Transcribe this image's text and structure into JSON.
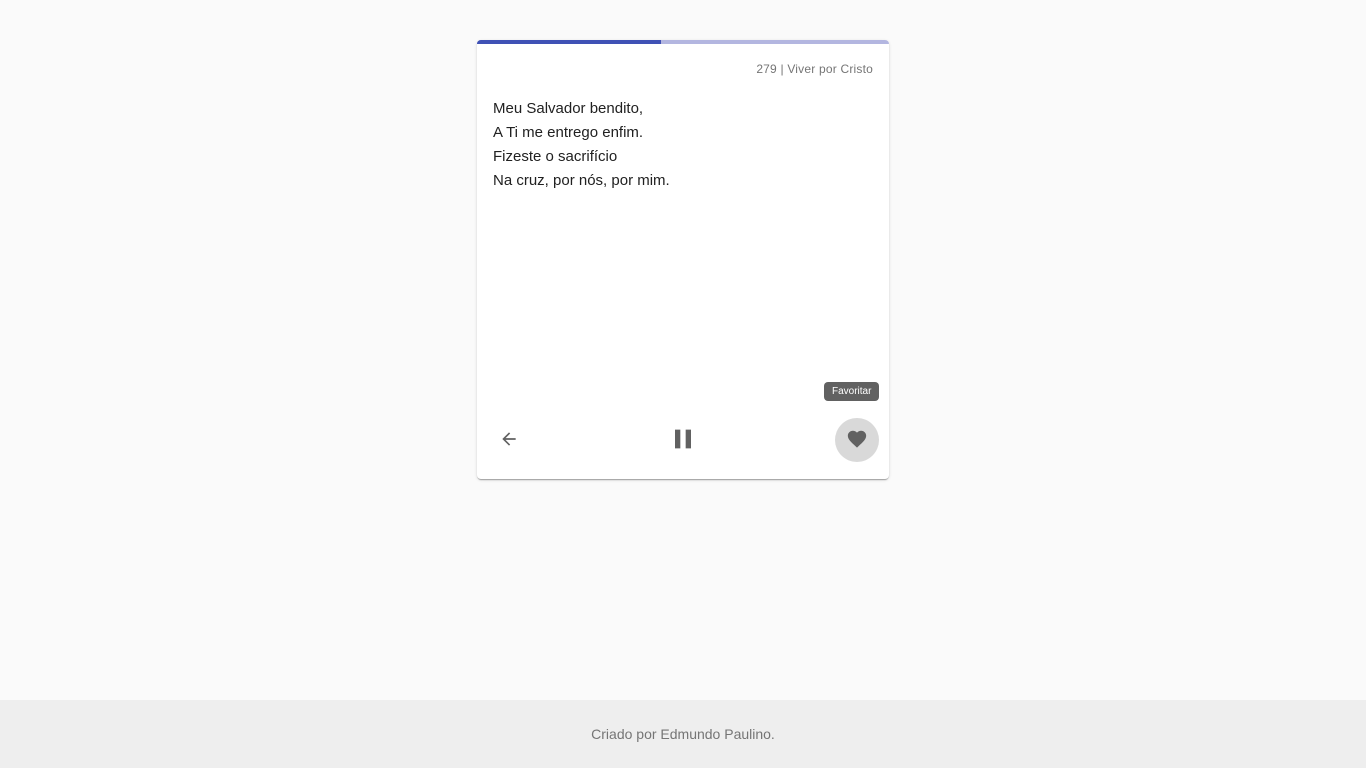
{
  "player": {
    "progress_fraction": 0.447,
    "hymn_title": "279 | Viver por Cristo",
    "lyrics": [
      "Meu Salvador bendito,",
      "A Ti me entrego enfim.",
      "Fizeste o sacrifício",
      "Na cruz, por nós, por mim."
    ],
    "tooltip": "Favoritar",
    "icons": {
      "back": "arrow-back-icon",
      "pause": "pause-icon",
      "favorite": "heart-icon"
    }
  },
  "footer": {
    "text": "Criado por Edmundo Paulino."
  },
  "colors": {
    "progress_fill": "#3f51b5",
    "progress_track": "#b3b6e0",
    "icon": "#616161",
    "background": "#fafafa"
  }
}
